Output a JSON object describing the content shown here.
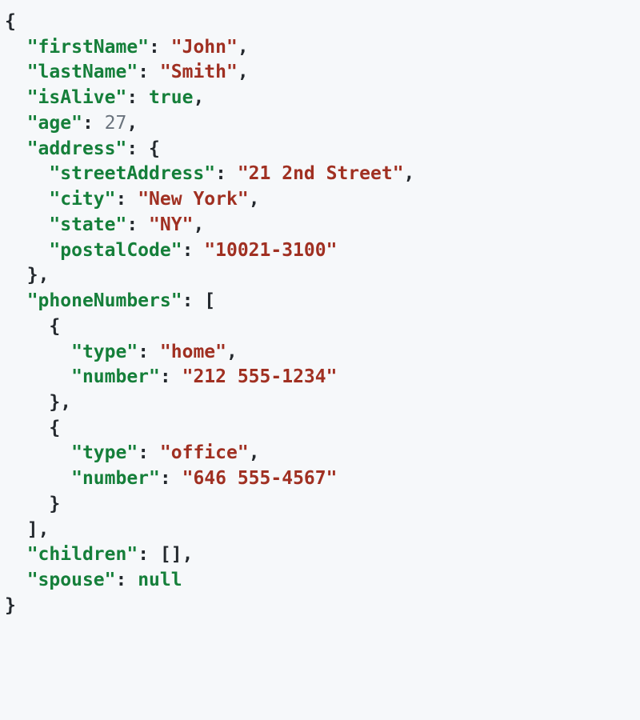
{
  "json_sample": {
    "firstName": {
      "key": "\"firstName\"",
      "value": "\"John\"",
      "type": "string"
    },
    "lastName": {
      "key": "\"lastName\"",
      "value": "\"Smith\"",
      "type": "string"
    },
    "isAlive": {
      "key": "\"isAlive\"",
      "value": "true",
      "type": "boolean"
    },
    "age": {
      "key": "\"age\"",
      "value": "27",
      "type": "number"
    },
    "address": {
      "key": "\"address\"",
      "streetAddress": {
        "key": "\"streetAddress\"",
        "value": "\"21 2nd Street\""
      },
      "city": {
        "key": "\"city\"",
        "value": "\"New York\""
      },
      "state": {
        "key": "\"state\"",
        "value": "\"NY\""
      },
      "postalCode": {
        "key": "\"postalCode\"",
        "value": "\"10021-3100\""
      }
    },
    "phoneNumbers": {
      "key": "\"phoneNumbers\"",
      "items": [
        {
          "typeKey": "\"type\"",
          "typeValue": "\"home\"",
          "numberKey": "\"number\"",
          "numberValue": "\"212 555-1234\""
        },
        {
          "typeKey": "\"type\"",
          "typeValue": "\"office\"",
          "numberKey": "\"number\"",
          "numberValue": "\"646 555-4567\""
        }
      ]
    },
    "children": {
      "key": "\"children\"",
      "value": "[]"
    },
    "spouse": {
      "key": "\"spouse\"",
      "value": "null",
      "type": "null"
    }
  },
  "punct": {
    "obrace": "{",
    "cbrace": "}",
    "obracket": "[",
    "cbracket": "]",
    "comma": ",",
    "colon": ":"
  }
}
